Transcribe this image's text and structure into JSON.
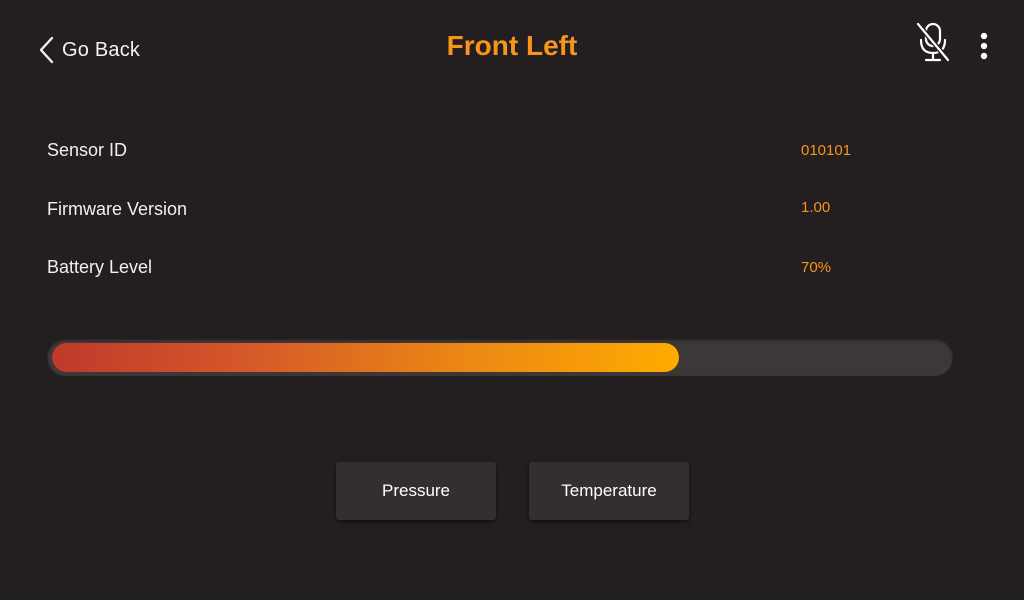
{
  "header": {
    "back_label": "Go Back",
    "title": "Front Left",
    "icons": {
      "back": "chevron-left-icon",
      "mute": "microphone-off-icon",
      "menu": "more-vertical-icon"
    }
  },
  "details": [
    {
      "label": "Sensor ID",
      "value": "010101"
    },
    {
      "label": "Firmware Version",
      "value": "1.00"
    },
    {
      "label": "Battery Level",
      "value": "70%"
    }
  ],
  "battery": {
    "level": 0.7,
    "gradient": [
      "#c0392b",
      "#ffab00"
    ]
  },
  "buttons": {
    "pressure": "Pressure",
    "temperature": "Temperature"
  },
  "colors": {
    "background": "#231f20",
    "accent": "#f7941d",
    "button": "#352e2f",
    "track": "#3d3737"
  }
}
